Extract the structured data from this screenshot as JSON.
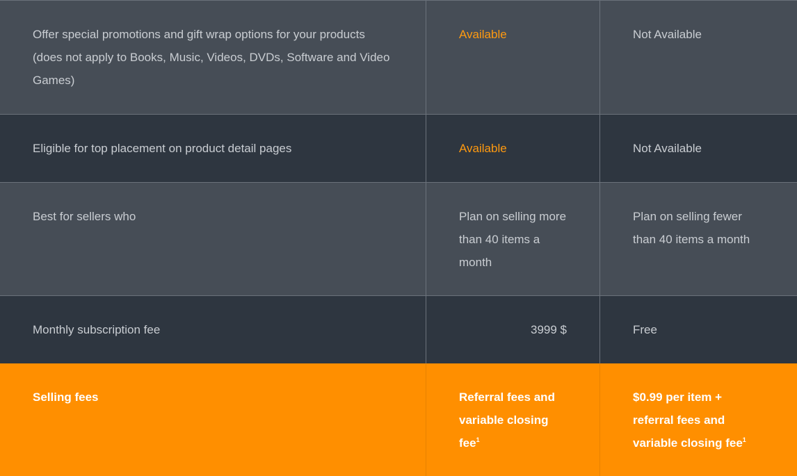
{
  "rows": [
    {
      "feature": "Offer special promotions and gift wrap options for your products (does not apply to Books, Music, Videos, DVDs, Software and Video Games)",
      "pro": "Available",
      "individual": "Not Available"
    },
    {
      "feature": "Eligible for top placement on product detail pages",
      "pro": "Available",
      "individual": "Not Available"
    },
    {
      "feature": "Best for sellers who",
      "pro": "Plan on selling more than 40 items a month",
      "individual": "Plan on selling fewer than 40 items a month"
    },
    {
      "feature": "Monthly subscription fee",
      "pro": "3999 $",
      "individual": "Free"
    }
  ],
  "footer": {
    "feature": "Selling fees",
    "pro": "Referral fees and variable closing fee",
    "pro_note": "1",
    "individual": "$0.99 per item + referral fees and variable closing fee",
    "individual_note": "1"
  },
  "colors": {
    "accent": "#ff8f00",
    "available_text": "#ff9a10",
    "row_light": "#464d56",
    "row_dark": "#2e3640"
  }
}
